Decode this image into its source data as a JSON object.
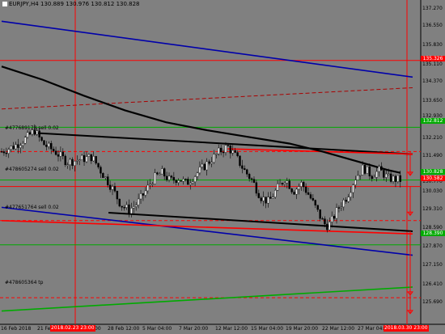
{
  "chart": {
    "symbol": "EURJPY,H4",
    "open": "130.889",
    "high": "130.976",
    "low": "130.812",
    "close": "130.828",
    "colors": {
      "background": "#808080",
      "bull_candle": "#ffffff",
      "bear_candle": "#000000",
      "channel_red": "#ff0000",
      "channel_blue": "#0000aa",
      "ma_black": "#000000",
      "level_green": "#00aa00"
    }
  },
  "price_axis": {
    "ticks": [
      "137.270",
      "136.550",
      "135.830",
      "135.110",
      "134.370",
      "133.650",
      "132.930",
      "132.210",
      "131.490",
      "130.770",
      "130.030",
      "129.310",
      "128.590",
      "127.870",
      "127.150",
      "126.410",
      "125.690"
    ],
    "badges": [
      {
        "label": "135.326",
        "color": "#ff0000"
      },
      {
        "label": "132.812",
        "color": "#00aa00"
      },
      {
        "label": "130.828",
        "color": "#00aa00"
      },
      {
        "label": "130.582",
        "color": "#ff0000"
      },
      {
        "label": "128.390",
        "color": "#00aa00"
      }
    ]
  },
  "time_axis": {
    "ticks": [
      "16 Feb 2018",
      "21 Feb",
      "00",
      "28 Feb 12:00",
      "5 Mar 04:00",
      "7 Mar 20:00",
      "12 Mar 12:00",
      "15 Mar 04:00",
      "19 Mar 20:00",
      "22 Mar 12:00",
      "27 Mar 04:00"
    ],
    "badges": [
      "2018.02.23 23:00",
      "2018.03.30 23:00"
    ]
  },
  "orders": [
    {
      "label": "#477689178 sell 0.02"
    },
    {
      "label": "#478605274 sell 0.02"
    },
    {
      "label": "#477651764 sell 0.02"
    },
    {
      "label": "#478605364 tp"
    }
  ],
  "chart_data": {
    "type": "candlestick",
    "title": "EURJPY,H4",
    "ohlc": {
      "open": 130.889,
      "high": 130.976,
      "low": 130.812,
      "close": 130.828
    },
    "ylim": [
      125.4,
      137.6
    ],
    "x_ticks": [
      "16 Feb 2018",
      "21 Feb",
      "28 Feb 12:00",
      "5 Mar 04:00",
      "7 Mar 20:00",
      "12 Mar 12:00",
      "15 Mar 04:00",
      "19 Mar 20:00",
      "22 Mar 12:00",
      "27 Mar 04:00"
    ],
    "horizontal_levels": [
      {
        "price": 135.326,
        "color": "#ff0000",
        "style": "solid"
      },
      {
        "price": 132.812,
        "color": "#00aa00",
        "style": "solid"
      },
      {
        "price": 130.828,
        "color": "#00aa00",
        "style": "solid"
      },
      {
        "price": 130.582,
        "color": "#ff0000",
        "style": "solid"
      },
      {
        "price": 128.39,
        "color": "#00aa00",
        "style": "solid"
      },
      {
        "price": 131.9,
        "color": "#ff0000",
        "style": "dashed"
      },
      {
        "price": 129.3,
        "color": "#ff0000",
        "style": "dashed"
      },
      {
        "price": 126.4,
        "color": "#ff0000",
        "style": "dashed"
      }
    ],
    "trendlines": [
      {
        "name": "",
        "color": "#0000aa",
        "from": [
          0,
          136.8
        ],
        "to": [
          1,
          134.7
        ]
      },
      {
        "name": "",
        "color": "#0000aa",
        "from": [
          0,
          129.8
        ],
        "to": [
          1,
          128.0
        ]
      },
      {
        "name": "",
        "color": "#000000",
        "from": [
          0.08,
          132.6
        ],
        "to": [
          1,
          131.8
        ]
      },
      {
        "name": "",
        "color": "#000000",
        "from": [
          0.26,
          129.6
        ],
        "to": [
          1,
          128.9
        ]
      },
      {
        "name": "",
        "color": "#ff0000",
        "from": [
          0.55,
          132.0
        ],
        "to": [
          1,
          131.8
        ]
      },
      {
        "name": "",
        "color": "#ff0000",
        "from": [
          0,
          129.3
        ],
        "to": [
          1,
          128.8
        ]
      },
      {
        "name": "",
        "color": "#00aa00",
        "from": [
          0,
          125.9
        ],
        "to": [
          1,
          126.8
        ]
      }
    ],
    "moving_average": [
      [
        0.0,
        135.1
      ],
      [
        0.1,
        134.6
      ],
      [
        0.2,
        134.0
      ],
      [
        0.3,
        133.45
      ],
      [
        0.4,
        133.0
      ],
      [
        0.5,
        132.7
      ],
      [
        0.6,
        132.45
      ],
      [
        0.7,
        132.2
      ],
      [
        0.78,
        131.9
      ],
      [
        0.86,
        131.55
      ],
      [
        0.94,
        131.2
      ],
      [
        0.97,
        131.1
      ]
    ],
    "close_path": [
      [
        0.0,
        131.9
      ],
      [
        0.03,
        132.1
      ],
      [
        0.06,
        132.4
      ],
      [
        0.08,
        132.7
      ],
      [
        0.1,
        132.2
      ],
      [
        0.13,
        131.9
      ],
      [
        0.16,
        131.5
      ],
      [
        0.19,
        131.6
      ],
      [
        0.22,
        131.7
      ],
      [
        0.24,
        131.2
      ],
      [
        0.27,
        130.5
      ],
      [
        0.29,
        129.9
      ],
      [
        0.31,
        129.7
      ],
      [
        0.33,
        129.95
      ],
      [
        0.35,
        130.4
      ],
      [
        0.37,
        130.9
      ],
      [
        0.39,
        131.1
      ],
      [
        0.41,
        130.8
      ],
      [
        0.43,
        130.9
      ],
      [
        0.45,
        130.7
      ],
      [
        0.47,
        131.0
      ],
      [
        0.49,
        131.3
      ],
      [
        0.51,
        131.6
      ],
      [
        0.53,
        131.9
      ],
      [
        0.55,
        132.1
      ],
      [
        0.57,
        131.7
      ],
      [
        0.59,
        131.2
      ],
      [
        0.61,
        130.8
      ],
      [
        0.63,
        130.2
      ],
      [
        0.65,
        130.0
      ],
      [
        0.67,
        130.5
      ],
      [
        0.69,
        130.9
      ],
      [
        0.71,
        130.4
      ],
      [
        0.73,
        130.7
      ],
      [
        0.75,
        130.2
      ],
      [
        0.77,
        129.6
      ],
      [
        0.78,
        129.3
      ],
      [
        0.79,
        129.1
      ],
      [
        0.8,
        129.2
      ],
      [
        0.82,
        129.8
      ],
      [
        0.84,
        130.2
      ],
      [
        0.86,
        130.9
      ],
      [
        0.88,
        131.3
      ],
      [
        0.9,
        131.0
      ],
      [
        0.92,
        131.2
      ],
      [
        0.94,
        130.9
      ],
      [
        0.96,
        130.85
      ],
      [
        0.97,
        130.83
      ]
    ]
  }
}
